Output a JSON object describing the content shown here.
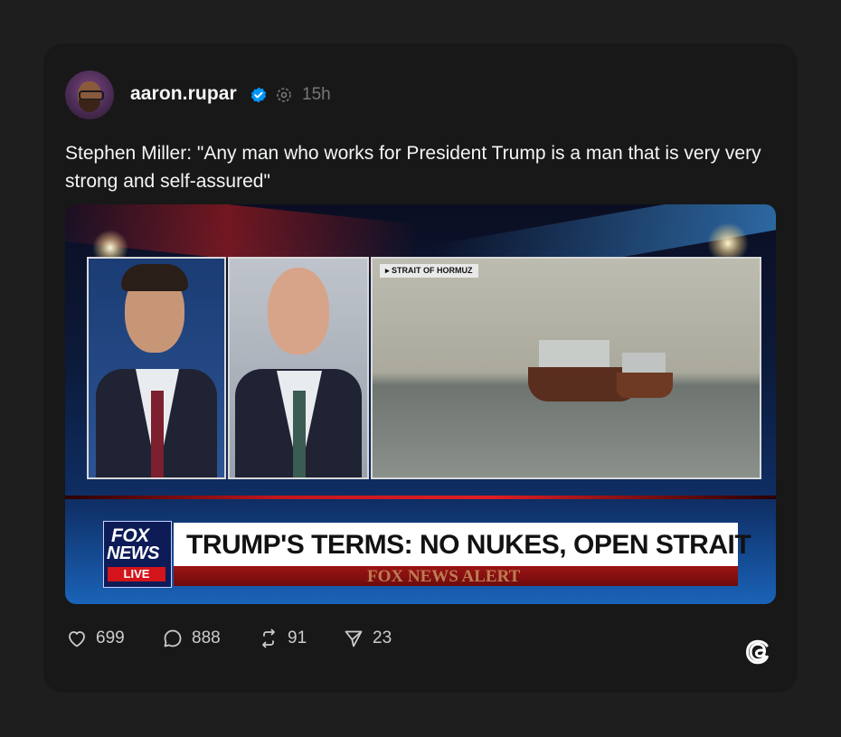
{
  "post": {
    "username": "aaron.rupar",
    "timestamp": "15h",
    "text": "Stephen Miller: \"Any man who works for President Trump is a man that is very very strong and self-assured\""
  },
  "media": {
    "inset_label": "▸ STRAIT OF HORMUZ",
    "network_line1": "FOX",
    "network_line2": "NEWS",
    "network_live": "LIVE",
    "headline": "TRUMP'S TERMS: NO NUKES, OPEN STRAIT",
    "alert_ticker": "FOX NEWS ALERT"
  },
  "actions": {
    "likes": "699",
    "replies": "888",
    "reposts": "91",
    "shares": "23"
  },
  "icons": {
    "verified": "verified-badge-icon",
    "repost": "repost-indicator-icon",
    "like": "heart-icon",
    "reply": "comment-icon",
    "repost_action": "repost-icon",
    "share": "send-icon",
    "brand": "threads-logo-icon"
  },
  "colors": {
    "background": "#1e1e1e",
    "card": "#181818",
    "verified_blue": "#0095f6",
    "fox_red": "#d3141b"
  }
}
